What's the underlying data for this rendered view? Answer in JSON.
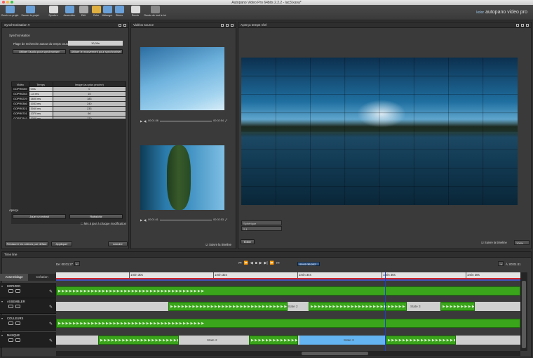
{
  "window_title": "Autopano Video Pro 64bits 2.2.2 - lac3.kava*",
  "toolbar": [
    {
      "label": "Ouvrir un projet",
      "icon": "folder-icon",
      "color": "#6aa0d8"
    },
    {
      "label": "Sauver le projet",
      "icon": "save-icon",
      "color": "#6aa0d8"
    },
    {
      "label": "Synchro",
      "icon": "clapper-icon",
      "color": "#dddddd"
    },
    {
      "label": "Assembler",
      "icon": "stitch-icon",
      "color": "#6aa0d8"
    },
    {
      "label": "Edit",
      "icon": "edit-icon",
      "color": "#aaaaaa"
    },
    {
      "label": "Color",
      "icon": "color-wheel-icon",
      "color": "#e0b040"
    },
    {
      "label": "Mélanger",
      "icon": "blend-icon",
      "color": "#6aa0d8"
    },
    {
      "label": "Stéréo",
      "icon": "stereo-icon",
      "color": "#6aa0d8"
    },
    {
      "label": "Rendu",
      "icon": "gear-icon",
      "color": "#dddddd"
    },
    {
      "label": "Rendu de tout le lot",
      "icon": "batch-gear-icon",
      "color": "#888888"
    }
  ],
  "brand": {
    "prefix": "kolor",
    "name": "autopano video pro"
  },
  "sync": {
    "panel_title": "Synchronisation ▾",
    "section": "Synchronisation",
    "range_label": "Plage de recherche autour du temps courant :",
    "range_value": "10,00s",
    "audio_btn": "Utiliser l'audio pour synchroniser",
    "motion_btn": "Utiliser le mouvement pour synchroniser",
    "headers": [
      "Vidéo",
      "Temps",
      "Image (au plus proche)"
    ],
    "rows": [
      {
        "video": "GOPR0089",
        "time": "0ms",
        "frame": "0"
      },
      {
        "video": "GOPR0263",
        "time": "-14 ms",
        "frame": "15"
      },
      {
        "video": "GOPR0229",
        "time": "1600 ms",
        "frame": "183"
      },
      {
        "video": "GOPR0366",
        "time": "1033 ms",
        "frame": "240"
      },
      {
        "video": "GOPR0321",
        "time": "3040 ms",
        "frame": "233"
      },
      {
        "video": "GOPR0701",
        "time": "1370 ms",
        "frame": "66"
      },
      {
        "video": "GOPR7849",
        "time": "1000 ms",
        "frame": "120"
      }
    ],
    "preview_section": "Aperçu",
    "play_btn": "Jouer un extrait",
    "refresh_btn": "Rafraîchir",
    "auto_update": "Mis à jour à chaque modification",
    "restore_btn": "Restaurer les valeurs par défaut",
    "apply_btn": "Appliquer",
    "cancel_btn": "Annuler"
  },
  "sources": {
    "panel_title": "Vidéos source",
    "clip1": {
      "current": "00:01:36",
      "duration": "00:02:54"
    },
    "clip2": {
      "current": "00:01:41",
      "duration": "00:02:53"
    },
    "follow": "Suivre la timeline"
  },
  "preview": {
    "panel_title": "Aperçu temps réel",
    "projection": "Sphérique",
    "ratio": "2:1",
    "edit_btn": "Éditer",
    "follow": "Suivre la timeline",
    "zoom": "100%"
  },
  "timeline": {
    "panel_title": "Time line",
    "start": "De: 00:01:27",
    "end": "À: 00:01:41",
    "current": "00:01:36,002",
    "tabs": [
      "Assemblage",
      "Création"
    ],
    "ruler": [
      "1min 30s",
      "1min 32s",
      "1min 34s",
      "1min 36s",
      "1min 38s"
    ],
    "playhead_fraction": 0.708,
    "tracks": [
      {
        "name": "HORIZON",
        "states": []
      },
      {
        "name": "ASSEMBLER",
        "states": [
          "State 2",
          "State 3"
        ]
      },
      {
        "name": "COULEURS",
        "states": []
      },
      {
        "name": "MASQUE",
        "states": [
          "State 2",
          "State 3"
        ]
      }
    ]
  }
}
